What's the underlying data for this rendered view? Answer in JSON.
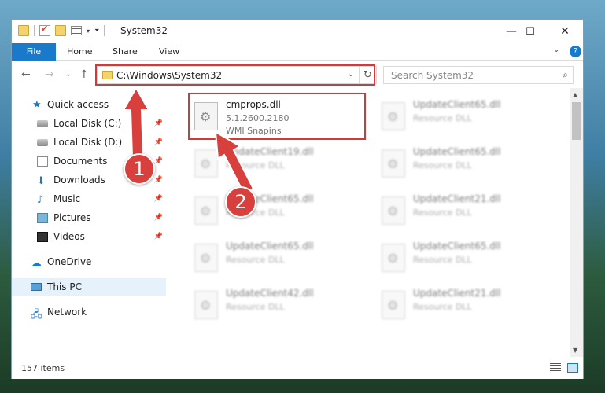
{
  "titlebar": {
    "title": "System32",
    "minimize": "—",
    "maximize": "☐",
    "close": "✕"
  },
  "ribbon": {
    "tabs": [
      "File",
      "Home",
      "Share",
      "View"
    ],
    "expand_icon": "chevron-down-icon",
    "help_label": "?"
  },
  "nav": {
    "address": "C:\\Windows\\System32",
    "search_placeholder": "Search System32"
  },
  "sidebar": {
    "items": [
      {
        "label": "Quick access",
        "icon": "star-icon"
      },
      {
        "label": "Local Disk (C:)",
        "icon": "disk-icon",
        "pinned": true
      },
      {
        "label": "Local Disk (D:)",
        "icon": "disk-icon",
        "pinned": true
      },
      {
        "label": "Documents",
        "icon": "documents-icon",
        "pinned": true
      },
      {
        "label": "Downloads",
        "icon": "downloads-icon",
        "pinned": true
      },
      {
        "label": "Music",
        "icon": "music-icon",
        "pinned": true
      },
      {
        "label": "Pictures",
        "icon": "pictures-icon",
        "pinned": true
      },
      {
        "label": "Videos",
        "icon": "videos-icon",
        "pinned": true
      },
      {
        "label": "OneDrive",
        "icon": "onedrive-icon"
      },
      {
        "label": "This PC",
        "icon": "pc-icon",
        "selected": true
      },
      {
        "label": "Network",
        "icon": "network-icon"
      }
    ]
  },
  "files": [
    {
      "name": "cmprops.dll",
      "line1": "5.1.2600.2180",
      "line2": "WMI Snapins"
    },
    {
      "name": "UpdateClient65.dll",
      "line1": "Resource DLL"
    },
    {
      "name": "UpdateClient19.dll",
      "line1": "Resource DLL"
    },
    {
      "name": "UpdateClient65.dll",
      "line1": "Resource DLL"
    },
    {
      "name": "UpdateClient65.dll",
      "line1": "Resource DLL"
    },
    {
      "name": "UpdateClient21.dll",
      "line1": "Resource DLL"
    },
    {
      "name": "UpdateClient65.dll",
      "line1": "Resource DLL"
    },
    {
      "name": "UpdateClient65.dll",
      "line1": "Resource DLL"
    },
    {
      "name": "UpdateClient42.dll",
      "line1": "Resource DLL"
    },
    {
      "name": "UpdateClient21.dll",
      "line1": "Resource DLL"
    }
  ],
  "status": {
    "item_count": "157 items"
  },
  "annotations": {
    "step1": "1",
    "step2": "2",
    "color": "#d8403d"
  }
}
